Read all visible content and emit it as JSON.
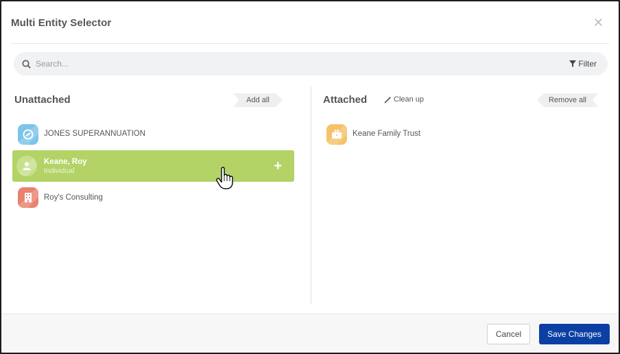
{
  "dialog": {
    "title": "Multi Entity Selector",
    "close_icon": "close-icon"
  },
  "search": {
    "placeholder": "Search...",
    "value": "",
    "filter_label": "Filter"
  },
  "unattached": {
    "title": "Unattached",
    "add_all_label": "Add all",
    "items": [
      {
        "name": "JONES SUPERANNUATION",
        "subtitle": "",
        "icon": "superannuation-icon",
        "color": "#7cc4ea"
      },
      {
        "name": "Keane, Roy",
        "subtitle": "Individual",
        "icon": "person-icon",
        "color": "#c7e08e",
        "selected": true
      },
      {
        "name": "Roy's Consulting",
        "subtitle": "",
        "icon": "building-icon",
        "color": "#e9826f"
      }
    ]
  },
  "attached": {
    "title": "Attached",
    "cleanup_label": "Clean up",
    "remove_all_label": "Remove all",
    "items": [
      {
        "name": "Keane Family Trust",
        "subtitle": "",
        "icon": "briefcase-icon",
        "color": "#f5c36a"
      }
    ]
  },
  "footer": {
    "cancel_label": "Cancel",
    "save_label": "Save Changes"
  },
  "colors": {
    "accent": "#0b3fa3",
    "selected_row": "#b3d366"
  }
}
